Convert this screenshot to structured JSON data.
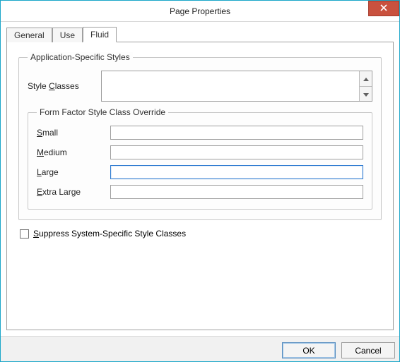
{
  "window": {
    "title": "Page Properties"
  },
  "tabs": {
    "general": "General",
    "use": "Use",
    "fluid": "Fluid",
    "active": "fluid"
  },
  "appStyles": {
    "legend": "Application-Specific Styles",
    "styleClassesLabel": "Style Classes",
    "styleClassesValue": ""
  },
  "formFactor": {
    "legend": "Form Factor Style Class Override",
    "smallLabel": "Small",
    "smallValue": "",
    "mediumLabel": "Medium",
    "mediumValue": "",
    "largeLabel": "Large",
    "largeValue": "",
    "extraLargeLabel": "Extra Large",
    "extraLargeValue": ""
  },
  "suppress": {
    "label": "Suppress System-Specific Style Classes",
    "checked": false
  },
  "buttons": {
    "ok": "OK",
    "cancel": "Cancel"
  }
}
